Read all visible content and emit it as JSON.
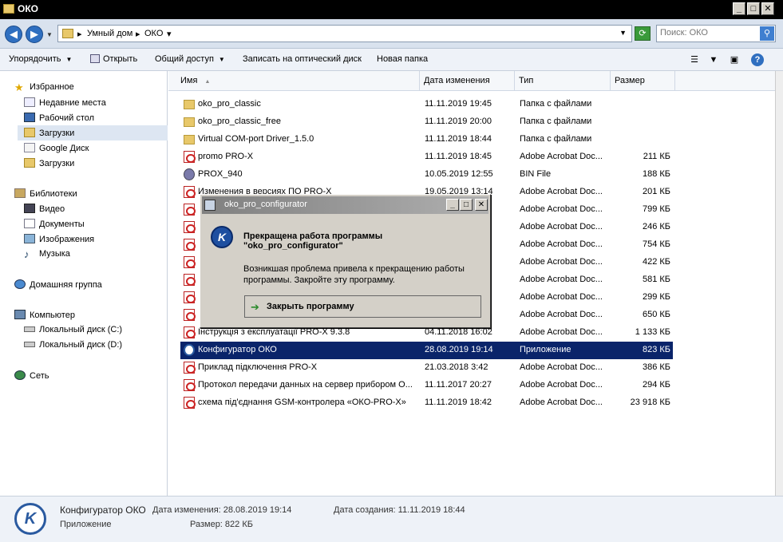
{
  "window": {
    "title": "ОКО"
  },
  "address": {
    "crumbs": [
      "Умный дом",
      "ОКО"
    ],
    "search_placeholder": "Поиск: ОКО"
  },
  "toolbar": {
    "organize": "Упорядочить",
    "open": "Открыть",
    "share": "Общий доступ",
    "burn": "Записать на оптический диск",
    "new_folder": "Новая папка"
  },
  "nav": {
    "favorites": "Избранное",
    "recent": "Недавние места",
    "desktop": "Рабочий стол",
    "downloads": "Загрузки",
    "gdrive": "Google Диск",
    "downloads2": "Загрузки",
    "libraries": "Библиотеки",
    "video": "Видео",
    "docs": "Документы",
    "images": "Изображения",
    "music": "Музыка",
    "homegroup": "Домашняя группа",
    "computer": "Компьютер",
    "disk_c": "Локальный диск (C:)",
    "disk_d": "Локальный диск (D:)",
    "network": "Сеть"
  },
  "columns": {
    "name": "Имя",
    "date": "Дата изменения",
    "type": "Тип",
    "size": "Размер"
  },
  "files": [
    {
      "name": "oko_pro_classic",
      "date": "11.11.2019 19:45",
      "type": "Папка с файлами",
      "size": "",
      "icon": "folder"
    },
    {
      "name": "oko_pro_classic_free",
      "date": "11.11.2019 20:00",
      "type": "Папка с файлами",
      "size": "",
      "icon": "folder"
    },
    {
      "name": "Virtual COM-port Driver_1.5.0",
      "date": "11.11.2019 18:44",
      "type": "Папка с файлами",
      "size": "",
      "icon": "folder"
    },
    {
      "name": "promo PRO-X",
      "date": "11.11.2019 18:45",
      "type": "Adobe Acrobat Doc...",
      "size": "211 КБ",
      "icon": "pdf"
    },
    {
      "name": "PROX_940",
      "date": "10.05.2019 12:55",
      "type": "BIN File",
      "size": "188 КБ",
      "icon": "bin"
    },
    {
      "name": "Изменения в версиях ПО PRO-X",
      "date": "19.05.2019 13:14",
      "type": "Adobe Acrobat Doc...",
      "size": "201 КБ",
      "icon": "pdf"
    },
    {
      "name": "",
      "date": "",
      "type": "Adobe Acrobat Doc...",
      "size": "799 КБ",
      "icon": "pdf"
    },
    {
      "name": "",
      "date": "",
      "type": "Adobe Acrobat Doc...",
      "size": "246 КБ",
      "icon": "pdf"
    },
    {
      "name": "",
      "date": "",
      "type": "Adobe Acrobat Doc...",
      "size": "754 КБ",
      "icon": "pdf"
    },
    {
      "name": "",
      "date": "",
      "type": "Adobe Acrobat Doc...",
      "size": "422 КБ",
      "icon": "pdf"
    },
    {
      "name": "",
      "date": "",
      "type": "Adobe Acrobat Doc...",
      "size": "581 КБ",
      "icon": "pdf"
    },
    {
      "name": "",
      "date": "",
      "type": "Adobe Acrobat Doc...",
      "size": "299 КБ",
      "icon": "pdf"
    },
    {
      "name": "",
      "date": "",
      "type": "Adobe Acrobat Doc...",
      "size": "650 КБ",
      "icon": "pdf"
    },
    {
      "name": "Інструкція з експлуатації PRO-X 9.3.8",
      "date": "04.11.2018 16:02",
      "type": "Adobe Acrobat Doc...",
      "size": "1 133 КБ",
      "icon": "pdf"
    },
    {
      "name": "Конфигуратор ОКО",
      "date": "28.08.2019 19:14",
      "type": "Приложение",
      "size": "823 КБ",
      "icon": "app",
      "selected": true
    },
    {
      "name": "Приклад підключення PRO-X",
      "date": "21.03.2018 3:42",
      "type": "Adobe Acrobat Doc...",
      "size": "386 КБ",
      "icon": "pdf"
    },
    {
      "name": "Протокол передачи данных на сервер прибором О...",
      "date": "11.11.2017 20:27",
      "type": "Adobe Acrobat Doc...",
      "size": "294 КБ",
      "icon": "pdf"
    },
    {
      "name": "схема під'єднання GSM-контролера «ОКО-PRO-X»",
      "date": "11.11.2019 18:42",
      "type": "Adobe Acrobat Doc...",
      "size": "23 918 КБ",
      "icon": "pdf"
    }
  ],
  "status": {
    "name": "Конфигуратор ОКО",
    "modified": "Дата изменения: 28.08.2019 19:14",
    "created": "Дата создания: 11.11.2019 18:44",
    "kind": "Приложение",
    "size": "Размер: 822 КБ"
  },
  "dialog": {
    "title": "oko_pro_configurator",
    "heading": "Прекращена работа программы\n\"oko_pro_configurator\"",
    "body": "Возникшая проблема привела к прекращению работы программы. Закройте эту программу.",
    "action": "Закрыть программу"
  }
}
